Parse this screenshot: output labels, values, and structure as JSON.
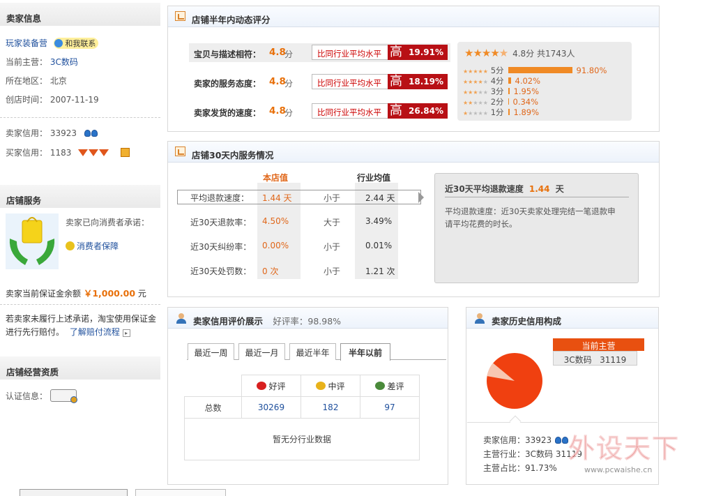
{
  "sidebar": {
    "seller_info_title": "卖家信息",
    "shop_name": "玩家装备营",
    "contact_label": "和我联系",
    "main_business_label": "当前主营：",
    "main_business_value": "3C数码",
    "region_label": "所在地区：",
    "region_value": "北京",
    "created_label": "创店时间：",
    "created_value": "2007-11-19",
    "seller_credit_label": "卖家信用：",
    "seller_credit_value": "33923",
    "buyer_credit_label": "买家信用：",
    "buyer_credit_value": "1183",
    "shop_service_title": "店铺服务",
    "promise_text": "卖家已向消费者承诺：",
    "consumer_protection": "消费者保障",
    "deposit_label": "卖家当前保证金余额",
    "deposit_value": "￥1,000.00",
    "deposit_unit": "元",
    "notice_text_1": "若卖家未履行上述承诺，淘宝使用保证金",
    "notice_text_2": "进行先行赔付。",
    "notice_link": "了解赔付流程",
    "qualification_title": "店铺经营资质",
    "certification_label": "认证信息："
  },
  "ratings_panel": {
    "title": "店铺半年内动态评分",
    "rows": [
      {
        "label": "宝贝与描述相符：",
        "score": "4.8",
        "unit": "分",
        "compare": "比同行业平均水平",
        "level": "高",
        "percent": "19.91%"
      },
      {
        "label": "卖家的服务态度：",
        "score": "4.8",
        "unit": "分",
        "compare": "比同行业平均水平",
        "level": "高",
        "percent": "18.19%"
      },
      {
        "label": "卖家发货的速度：",
        "score": "4.8",
        "unit": "分",
        "compare": "比同行业平均水平",
        "level": "高",
        "percent": "26.84%"
      }
    ],
    "summary": "4.8分 共1743人",
    "distribution": [
      {
        "label": "5分",
        "percent": "91.80%",
        "fraction": 0.918
      },
      {
        "label": "4分",
        "percent": "4.02%",
        "fraction": 0.0402
      },
      {
        "label": "3分",
        "percent": "1.95%",
        "fraction": 0.0195
      },
      {
        "label": "2分",
        "percent": "0.34%",
        "fraction": 0.0034
      },
      {
        "label": "1分",
        "percent": "1.89%",
        "fraction": 0.0189
      }
    ]
  },
  "service_panel": {
    "title": "店铺30天内服务情况",
    "col_shop": "本店值",
    "col_industry": "行业均值",
    "rows": [
      {
        "label": "平均退款速度：",
        "shop": "1.44 天",
        "cmp": "小于",
        "industry": "2.44 天"
      },
      {
        "label": "近30天退款率：",
        "shop": "4.50%",
        "cmp": "大于",
        "industry": "3.49%"
      },
      {
        "label": "近30天纠纷率：",
        "shop": "0.00%",
        "cmp": "小于",
        "industry": "0.01%"
      },
      {
        "label": "近30天处罚数：",
        "shop": "0 次",
        "cmp": "小于",
        "industry": "1.21 次"
      }
    ],
    "detail_title": "近30天平均退款速度",
    "detail_value": "1.44",
    "detail_unit": "天",
    "detail_text_1": "平均退款速度：近30天卖家处理完结一笔退款申",
    "detail_text_2": "请平均花费的时长。"
  },
  "credit_panel": {
    "title": "卖家信用评价展示",
    "good_rate": "好评率：98.98%",
    "tabs": [
      "最近一周",
      "最近一月",
      "最近半年",
      "半年以前"
    ],
    "col_good": "好评",
    "col_neutral": "中评",
    "col_bad": "差评",
    "row_label": "总数",
    "good": "30269",
    "neutral": "182",
    "bad": "97",
    "no_data": "暂无分行业数据"
  },
  "history_panel": {
    "title": "卖家历史信用构成",
    "tag_label": "当前主营",
    "tag_value": "3C数码   31119",
    "seller_credit": "卖家信用：33923",
    "main_industry": "主营行业：3C数码  31119",
    "ratio": "主营占比：91.73%",
    "ratio_fraction": 0.9173
  },
  "watermark": {
    "logo": "外设天下",
    "url": "www.pcwaishe.cn"
  },
  "colors": {
    "accent_orange": "#e8700a",
    "high_red": "#b81015",
    "pie_red": "#f04010"
  }
}
